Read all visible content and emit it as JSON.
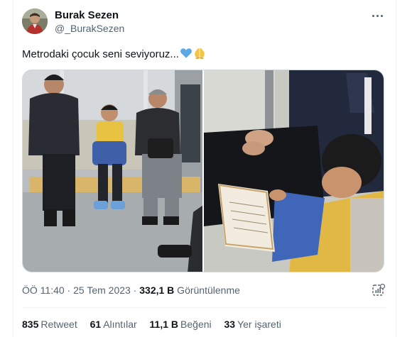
{
  "author": {
    "display_name": "Burak Sezen",
    "handle": "@_BurakSezen"
  },
  "tweet": {
    "text": "Metrodaki çocuk seni seviyoruz...",
    "emojis": [
      "blue-heart-icon",
      "folded-hands-icon"
    ]
  },
  "media": {
    "photos": [
      "photo-left",
      "photo-right"
    ]
  },
  "meta": {
    "timestamp": "ÖÖ 11:40 · 25 Tem 2023 · ",
    "views_count": "332,1 B",
    "views_label": " Görüntülenme"
  },
  "stats": {
    "retweets": {
      "count": "835",
      "label": "Retweet"
    },
    "quotes": {
      "count": "61",
      "label": "Alıntılar"
    },
    "likes": {
      "count": "11,1 B",
      "label": "Beğeni"
    },
    "bookmarks": {
      "count": "33",
      "label": "Yer işareti"
    }
  },
  "colors": {
    "text": "#0f1419",
    "secondary": "#536471",
    "border": "#cfd9de",
    "heart_blue": "#5aa9e6",
    "hands_yellow": "#f5c542"
  }
}
